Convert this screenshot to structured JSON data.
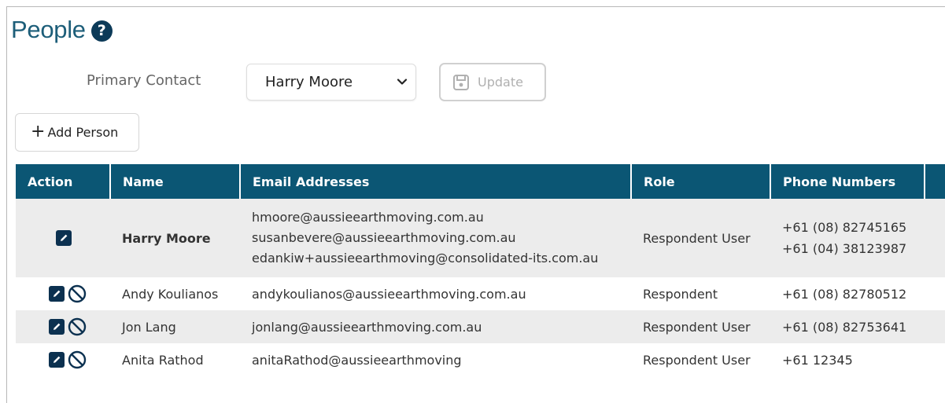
{
  "header": {
    "title": "People",
    "help_icon": "question-icon"
  },
  "primary_contact": {
    "label": "Primary Contact",
    "selected": "Harry Moore",
    "update_label": "Update"
  },
  "add_person_label": "Add Person",
  "colors": {
    "header_bg": "#0b5674",
    "title": "#1d5e79",
    "row_alt": "#ececec"
  },
  "table": {
    "columns": [
      "Action",
      "Name",
      "Email Addresses",
      "Role",
      "Phone Numbers"
    ],
    "rows": [
      {
        "name": "Harry Moore",
        "emails": [
          "hmoore@aussieearthmoving.com.au",
          "susanbevere@aussieearthmoving.com.au",
          "edankiw+aussieearthmoving@consolidated-its.com.au"
        ],
        "role": "Respondent User",
        "phones": [
          "+61 (08) 82745165",
          "+61 (04) 38123987"
        ],
        "actions": [
          "edit-icon"
        ]
      },
      {
        "name": "Andy Koulianos",
        "emails": [
          "andykoulianos@aussieearthmoving.com.au"
        ],
        "role": "Respondent",
        "phones": [
          "+61 (08) 82780512"
        ],
        "actions": [
          "edit-icon",
          "block-icon"
        ]
      },
      {
        "name": "Jon Lang",
        "emails": [
          "jonlang@aussieearthmoving.com.au"
        ],
        "role": "Respondent User",
        "phones": [
          "+61 (08) 82753641"
        ],
        "actions": [
          "edit-icon",
          "block-icon"
        ]
      },
      {
        "name": "Anita Rathod",
        "emails": [
          "anitaRathod@aussieearthmoving"
        ],
        "role": "Respondent User",
        "phones": [
          "+61 12345"
        ],
        "actions": [
          "edit-icon",
          "block-icon"
        ]
      }
    ]
  }
}
